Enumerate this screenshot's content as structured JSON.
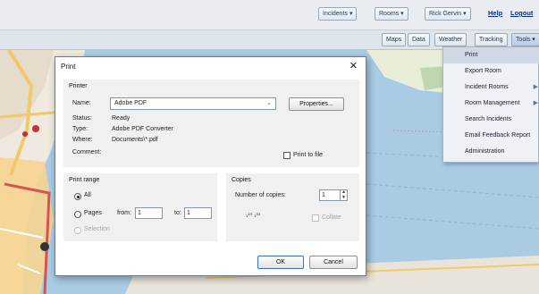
{
  "topbar": {
    "incidents_label": "Incidents ▾",
    "rooms_label": "Rooms ▾",
    "user_label": "Rick Gervin ▾",
    "help_label": "Help",
    "logout_label": "Logout"
  },
  "toolbar": {
    "maps_label": "Maps",
    "data_label": "Data",
    "weather_label": "Weather",
    "tracking_label": "Tracking",
    "tools_label": "Tools ▾"
  },
  "tools_menu": {
    "items": [
      {
        "label": "Print",
        "submenu": false
      },
      {
        "label": "Export Room",
        "submenu": false
      },
      {
        "label": "Incident Rooms",
        "submenu": true
      },
      {
        "label": "Room Management",
        "submenu": true
      },
      {
        "label": "Search Incidents",
        "submenu": false
      },
      {
        "label": "Email Feedback Report",
        "submenu": false
      },
      {
        "label": "Administration",
        "submenu": false
      }
    ]
  },
  "print_dialog": {
    "title": "Print",
    "printer": {
      "group_label": "Printer",
      "name_label": "Name:",
      "name_value": "Adobe PDF",
      "properties_label": "Properties...",
      "status_label": "Status:",
      "status_value": "Ready",
      "type_label": "Type:",
      "type_value": "Adobe PDF Converter",
      "where_label": "Where:",
      "where_value": "Documents\\*.pdf",
      "comment_label": "Comment:",
      "print_to_file_label": "Print to file",
      "print_to_file_checked": false
    },
    "print_range": {
      "group_label": "Print range",
      "all_label": "All",
      "pages_label": "Pages",
      "from_label": "from:",
      "from_value": "1",
      "to_label": "to:",
      "to_value": "1",
      "selection_label": "Selection",
      "selected": "All"
    },
    "copies": {
      "group_label": "Copies",
      "number_label": "Number of copies:",
      "number_value": "1",
      "collate_label": "Collate",
      "collate_checked": false
    },
    "ok_label": "OK",
    "cancel_label": "Cancel"
  },
  "colors": {
    "map_water": "#a9cbe4",
    "map_land": "#efe9df",
    "map_road_major": "#f2c86a",
    "map_road_red": "#d9534f",
    "map_area_orange": "#f6d591",
    "menu_highlight": "#cfd9e6"
  }
}
